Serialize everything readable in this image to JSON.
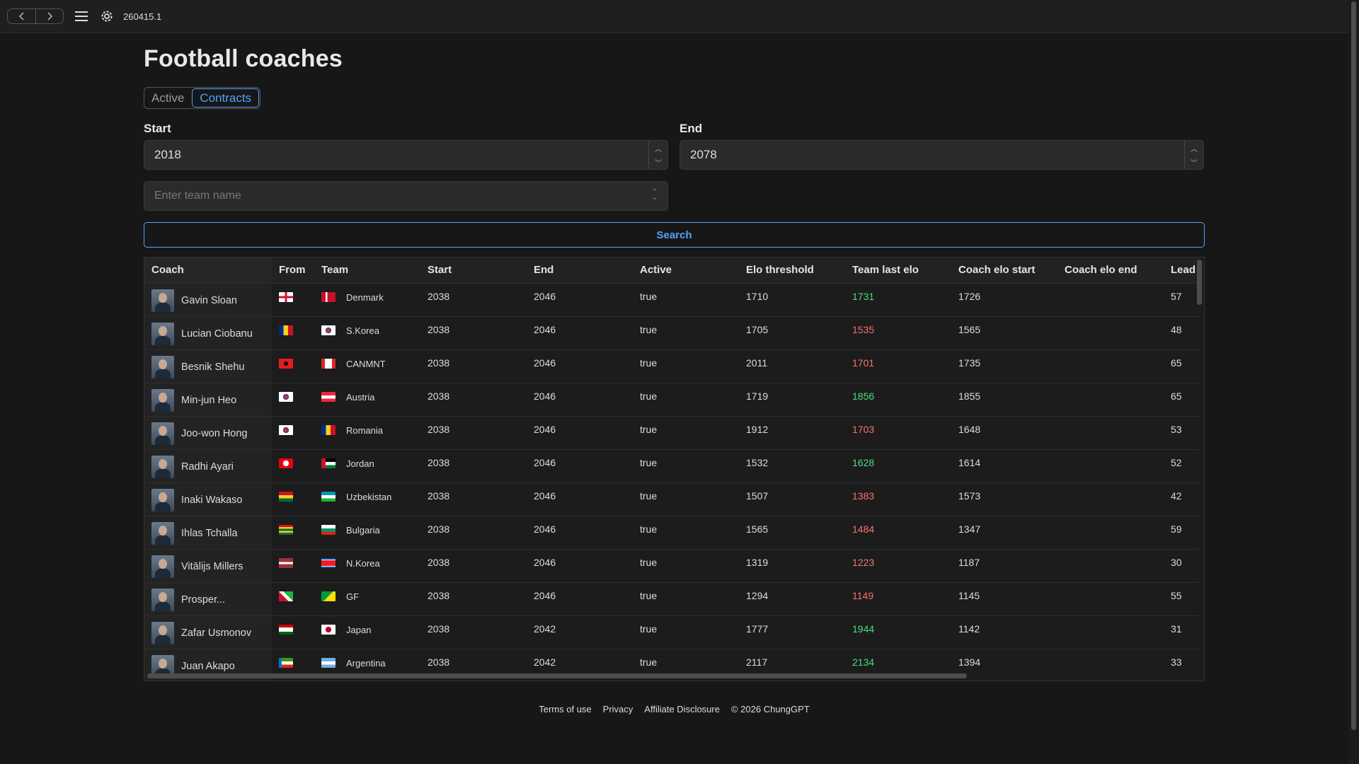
{
  "topbar": {
    "version": "260415.1",
    "icons": [
      "chevron-left-icon",
      "chevron-right-icon",
      "menu-icon",
      "gear-icon"
    ]
  },
  "page": {
    "title": "Football coaches",
    "tabs": [
      {
        "label": "Active",
        "selected": false
      },
      {
        "label": "Contracts",
        "selected": true
      }
    ]
  },
  "filters": {
    "start_label": "Start",
    "start_value": "2018",
    "end_label": "End",
    "end_value": "2078",
    "team_placeholder": "Enter team name",
    "search_label": "Search"
  },
  "table": {
    "columns": [
      "Coach",
      "From",
      "Team",
      "Start",
      "End",
      "Active",
      "Elo threshold",
      "Team last elo",
      "Coach elo start",
      "Coach elo end",
      "Lead"
    ],
    "rows": [
      {
        "coach": "Gavin Sloan",
        "from": "eng",
        "team": "Denmark",
        "team_flag": "dk",
        "start": "2038",
        "end": "2046",
        "active": "true",
        "elo_threshold": "1710",
        "team_last_elo": "1731",
        "trend": "up",
        "coach_elo_start": "1726",
        "coach_elo_end": "",
        "lead": "57"
      },
      {
        "coach": "Lucian Ciobanu",
        "from": "ro",
        "team": "S.Korea",
        "team_flag": "kr",
        "start": "2038",
        "end": "2046",
        "active": "true",
        "elo_threshold": "1705",
        "team_last_elo": "1535",
        "trend": "down",
        "coach_elo_start": "1565",
        "coach_elo_end": "",
        "lead": "48"
      },
      {
        "coach": "Besnik Shehu",
        "from": "al",
        "team": "CANMNT",
        "team_flag": "ca",
        "start": "2038",
        "end": "2046",
        "active": "true",
        "elo_threshold": "2011",
        "team_last_elo": "1701",
        "trend": "down",
        "coach_elo_start": "1735",
        "coach_elo_end": "",
        "lead": "65"
      },
      {
        "coach": "Min-jun Heo",
        "from": "kr",
        "team": "Austria",
        "team_flag": "at",
        "start": "2038",
        "end": "2046",
        "active": "true",
        "elo_threshold": "1719",
        "team_last_elo": "1856",
        "trend": "up",
        "coach_elo_start": "1855",
        "coach_elo_end": "",
        "lead": "65"
      },
      {
        "coach": "Joo-won Hong",
        "from": "kr",
        "team": "Romania",
        "team_flag": "ro",
        "start": "2038",
        "end": "2046",
        "active": "true",
        "elo_threshold": "1912",
        "team_last_elo": "1703",
        "trend": "down",
        "coach_elo_start": "1648",
        "coach_elo_end": "",
        "lead": "53"
      },
      {
        "coach": "Radhi Ayari",
        "from": "tn",
        "team": "Jordan",
        "team_flag": "jo",
        "start": "2038",
        "end": "2046",
        "active": "true",
        "elo_threshold": "1532",
        "team_last_elo": "1628",
        "trend": "up",
        "coach_elo_start": "1614",
        "coach_elo_end": "",
        "lead": "52"
      },
      {
        "coach": "Inaki Wakaso",
        "from": "gh",
        "team": "Uzbekistan",
        "team_flag": "uz",
        "start": "2038",
        "end": "2046",
        "active": "true",
        "elo_threshold": "1507",
        "team_last_elo": "1383",
        "trend": "down",
        "coach_elo_start": "1573",
        "coach_elo_end": "",
        "lead": "42"
      },
      {
        "coach": "Ihlas Tchalla",
        "from": "tg",
        "team": "Bulgaria",
        "team_flag": "bg",
        "start": "2038",
        "end": "2046",
        "active": "true",
        "elo_threshold": "1565",
        "team_last_elo": "1484",
        "trend": "down",
        "coach_elo_start": "1347",
        "coach_elo_end": "",
        "lead": "59"
      },
      {
        "coach": "Vitālijs Millers",
        "from": "lv",
        "team": "N.Korea",
        "team_flag": "kp",
        "start": "2038",
        "end": "2046",
        "active": "true",
        "elo_threshold": "1319",
        "team_last_elo": "1223",
        "trend": "down",
        "coach_elo_start": "1187",
        "coach_elo_end": "",
        "lead": "30"
      },
      {
        "coach": "Prosper...",
        "from": "bi",
        "team": "GF",
        "team_flag": "gf",
        "start": "2038",
        "end": "2046",
        "active": "true",
        "elo_threshold": "1294",
        "team_last_elo": "1149",
        "trend": "down",
        "coach_elo_start": "1145",
        "coach_elo_end": "",
        "lead": "55"
      },
      {
        "coach": "Zafar Usmonov",
        "from": "tj",
        "team": "Japan",
        "team_flag": "jp",
        "start": "2038",
        "end": "2042",
        "active": "true",
        "elo_threshold": "1777",
        "team_last_elo": "1944",
        "trend": "up",
        "coach_elo_start": "1142",
        "coach_elo_end": "",
        "lead": "31"
      },
      {
        "coach": "Juan Akapo",
        "from": "gq",
        "team": "Argentina",
        "team_flag": "ar",
        "start": "2038",
        "end": "2042",
        "active": "true",
        "elo_threshold": "2117",
        "team_last_elo": "2134",
        "trend": "up",
        "coach_elo_start": "1394",
        "coach_elo_end": "",
        "lead": "33"
      }
    ],
    "colors": {
      "up": "#4ade80",
      "down": "#f87171"
    }
  },
  "footer": {
    "links": [
      "Terms of use",
      "Privacy",
      "Affiliate Disclosure"
    ],
    "copyright": "© 2026 ChungGPT"
  }
}
